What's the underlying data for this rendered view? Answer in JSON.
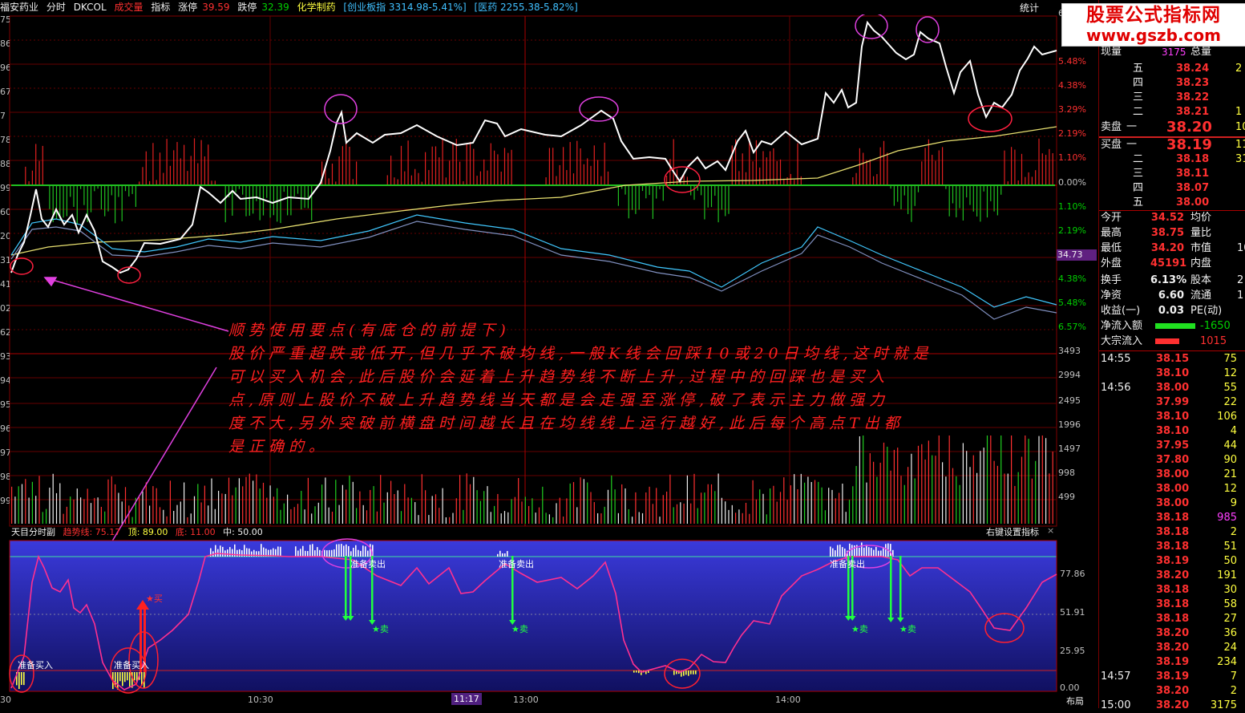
{
  "topbar": {
    "stock": "福安药业",
    "tabs": [
      "分时",
      "DKCOL",
      "成交量",
      "指标"
    ],
    "limit_up_label": "涨停",
    "limit_up_value": "39.59",
    "limit_down_label": "跌停",
    "limit_down_value": "32.39",
    "sector": "化学制药",
    "index1": "[创业板指 3314.98-5.41%]",
    "index2": "[医药 2255.38-5.82%]",
    "stats": "统计"
  },
  "logo": {
    "line1": "股票公式指标网",
    "line2": "www.gszb.com"
  },
  "left_axis": [
    "75",
    "86",
    "96",
    "67",
    "7",
    "78",
    "88",
    "99",
    "60",
    "20",
    "31",
    "41",
    "02",
    "62",
    "93",
    "94",
    "95",
    "96",
    "97",
    "98",
    "99"
  ],
  "right_axis": [
    "6",
    "5.48%",
    "4.38%",
    "3.29%",
    "2.19%",
    "1.10%",
    "0.00%",
    "1.10%",
    "2.19%",
    "34.73",
    "4.38%",
    "5.48%",
    "6.57%",
    "3493",
    "2994",
    "2495",
    "1996",
    "1497",
    "998",
    "499"
  ],
  "price_tag": "34.73",
  "note": [
    "顺势使用要点(有底仓的前提下)",
    "股价严重超跌或低开,但几乎不破均线,一般K线会回踩10或20日均线,这时就是",
    "可以买入机会,此后股价会延着上升趋势线不断上升,过程中的回踩也是买入",
    "点,原则上股价不破上升趋势线当天都是会走强至涨停,破了表示主力做强力",
    "度不大,另外突破前横盘时间越长且在均线线上运行越好,此后每个高点T出都",
    "是正确的。"
  ],
  "indicator": {
    "name": "天目分时副",
    "trend_label": "趋势线: 75.17",
    "top_label": "顶: 89.00",
    "bottom_label": "底: 11.00",
    "mid_label": "中: 50.00",
    "settings": "右键设置指标",
    "close": "×",
    "axis": [
      "77.86",
      "51.91",
      "25.95",
      "0.00"
    ],
    "annotations": {
      "prep_buy": "准备买入",
      "prep_sell": "准备卖出",
      "buy": "★买",
      "sell": "★卖"
    }
  },
  "time_axis": [
    "30",
    "10:30",
    "11:17",
    "13:00",
    "14:00",
    "布局"
  ],
  "quote": {
    "vol_label": "现量",
    "vol_value": "3175",
    "total_label": "总量",
    "asks": [
      {
        "label": "五",
        "price": "38.24",
        "vol": "2"
      },
      {
        "label": "四",
        "price": "38.23",
        "vol": ""
      },
      {
        "label": "三",
        "price": "38.22",
        "vol": ""
      },
      {
        "label": "二",
        "price": "38.21",
        "vol": "1"
      }
    ],
    "ask1_label": "卖盘",
    "ask1_sub": "一",
    "ask1_price": "38.20",
    "ask1_vol": "10",
    "bid1_label": "买盘",
    "bid1_sub": "一",
    "bid1_price": "38.19",
    "bid1_vol": "11",
    "bids": [
      {
        "label": "二",
        "price": "38.18",
        "vol": "31"
      },
      {
        "label": "三",
        "price": "38.11",
        "vol": ""
      },
      {
        "label": "四",
        "price": "38.07",
        "vol": ""
      },
      {
        "label": "五",
        "price": "38.00",
        "vol": ""
      }
    ],
    "stats": [
      {
        "l1": "今开",
        "v1": "34.52",
        "l2": "均价",
        "c": "red"
      },
      {
        "l1": "最高",
        "v1": "38.75",
        "l2": "量比",
        "c": "red"
      },
      {
        "l1": "最低",
        "v1": "34.20",
        "l2": "市值",
        "c": "red",
        "v2": "10"
      },
      {
        "l1": "外盘",
        "v1": "45191",
        "l2": "内盘",
        "c": "red"
      },
      {
        "l1": "换手",
        "v1": "6.13%",
        "l2": "股本",
        "c": "white",
        "v2": "2"
      },
      {
        "l1": "净资",
        "v1": "6.60",
        "l2": "流通",
        "c": "white",
        "v2": "1"
      },
      {
        "l1": "收益(一)",
        "v1": "0.03",
        "l2": "PE(动)",
        "c": "white"
      }
    ],
    "net_inflow_label": "净流入额",
    "net_inflow_value": "-1650",
    "block_label": "大宗流入",
    "block_value": "1015",
    "ticks": [
      {
        "t": "14:55",
        "p": "38.15",
        "v": "75",
        "c": "red"
      },
      {
        "t": "",
        "p": "38.10",
        "v": "12",
        "c": "red"
      },
      {
        "t": "14:56",
        "p": "38.00",
        "v": "55",
        "c": "red"
      },
      {
        "t": "",
        "p": "37.99",
        "v": "22",
        "c": "red"
      },
      {
        "t": "",
        "p": "38.10",
        "v": "106",
        "c": "red"
      },
      {
        "t": "",
        "p": "38.10",
        "v": "4",
        "c": "red"
      },
      {
        "t": "",
        "p": "37.95",
        "v": "44",
        "c": "red"
      },
      {
        "t": "",
        "p": "37.80",
        "v": "90",
        "c": "red"
      },
      {
        "t": "",
        "p": "38.00",
        "v": "21",
        "c": "red"
      },
      {
        "t": "",
        "p": "38.00",
        "v": "12",
        "c": "red"
      },
      {
        "t": "",
        "p": "38.00",
        "v": "9",
        "c": "red"
      },
      {
        "t": "",
        "p": "38.18",
        "v": "985",
        "c": "mag"
      },
      {
        "t": "",
        "p": "38.18",
        "v": "2",
        "c": "red"
      },
      {
        "t": "",
        "p": "38.18",
        "v": "51",
        "c": "red"
      },
      {
        "t": "",
        "p": "38.19",
        "v": "50",
        "c": "red"
      },
      {
        "t": "",
        "p": "38.20",
        "v": "191",
        "c": "red"
      },
      {
        "t": "",
        "p": "38.18",
        "v": "30",
        "c": "red"
      },
      {
        "t": "",
        "p": "38.18",
        "v": "58",
        "c": "red"
      },
      {
        "t": "",
        "p": "38.18",
        "v": "27",
        "c": "red"
      },
      {
        "t": "",
        "p": "38.20",
        "v": "36",
        "c": "red"
      },
      {
        "t": "",
        "p": "38.20",
        "v": "24",
        "c": "red"
      },
      {
        "t": "",
        "p": "38.19",
        "v": "234",
        "c": "red"
      },
      {
        "t": "14:57",
        "p": "38.19",
        "v": "7",
        "c": "red"
      },
      {
        "t": "",
        "p": "38.20",
        "v": "2",
        "c": "red"
      },
      {
        "t": "15:00",
        "p": "38.20",
        "v": "3175",
        "c": "red"
      }
    ]
  },
  "colors": {
    "grid": "#800000",
    "panel_blue": "#3030c0",
    "price": "#ffffff",
    "avg": "#e8e070",
    "magenta": "#ff40ff",
    "sell_green": "#20ff40"
  }
}
